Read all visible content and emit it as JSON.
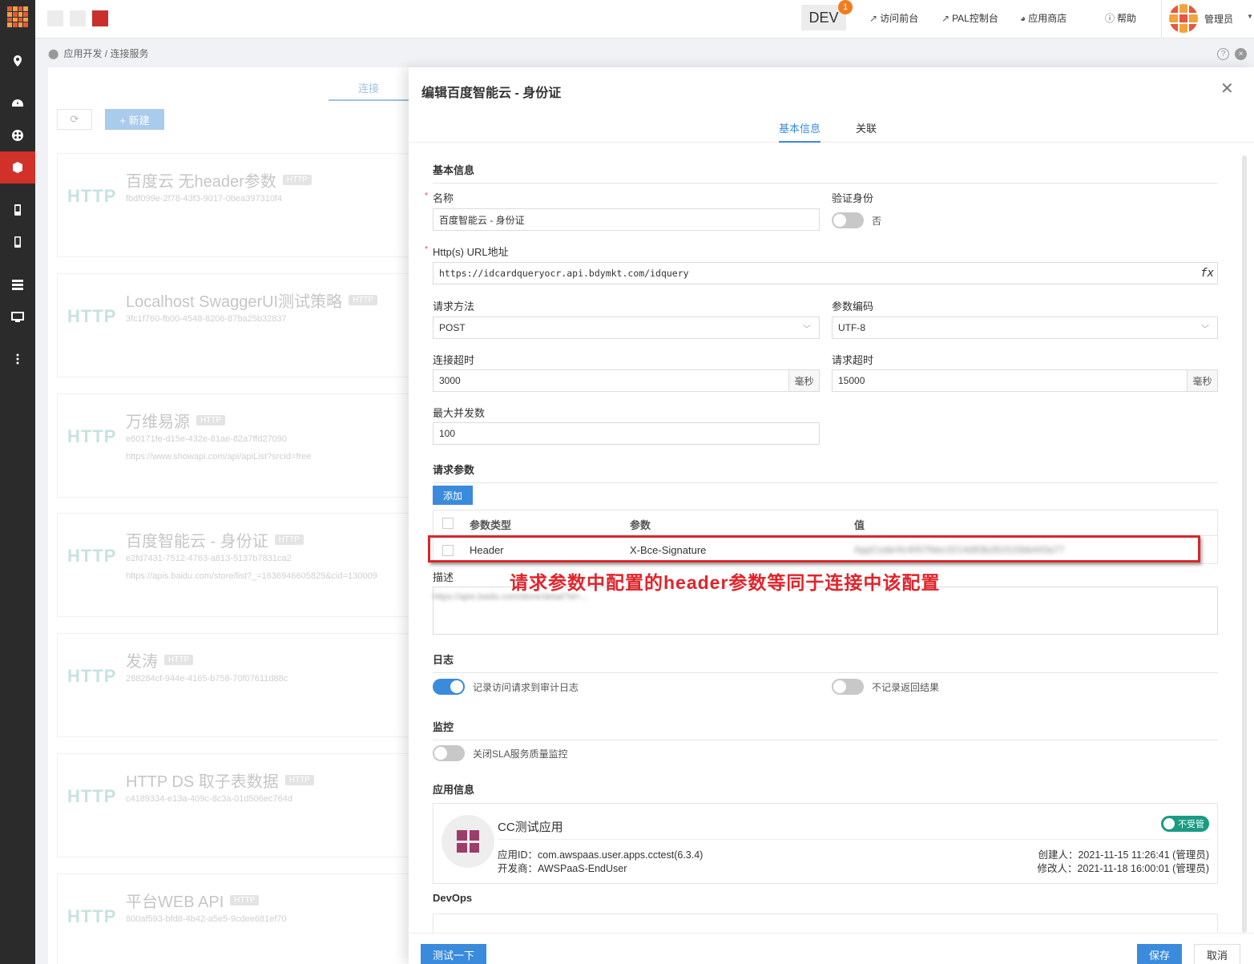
{
  "topbar": {
    "env": "DEV",
    "env_badge": "1",
    "links": {
      "front": "访问前台",
      "pal": "PAL控制台",
      "store": "应用商店",
      "help": "帮助"
    },
    "user": "管理员"
  },
  "breadcrumb": "应用开发 / 连接服务",
  "list": {
    "tab": "连接",
    "new_button": "+ 新建",
    "cards": [
      {
        "protocol": "HTTP",
        "name": "百度云 无header参数",
        "badge": "HTTP",
        "id": "fbdf099e-2f78-43f3-9017-0bea397310f4",
        "url": ""
      },
      {
        "protocol": "HTTP",
        "name": "Localhost SwaggerUI测试策略",
        "badge": "HTTP",
        "id": "3fc1f760-fb00-4548-8206-87ba25b32837",
        "url": ""
      },
      {
        "protocol": "HTTP",
        "name": "万维易源",
        "badge": "HTTP",
        "id": "e60171fe-d15e-432e-81ae-82a7ffd27090",
        "url": "https://www.showapi.com/api/apiList?srcId=free"
      },
      {
        "protocol": "HTTP",
        "name": "百度智能云 - 身份证",
        "badge": "HTTP",
        "id": "e2fd7431-7512-4763-a813-5137b7831ca2",
        "url": "https://apis.baidu.com/store/list?_=1636946605829&cid=130009"
      },
      {
        "protocol": "HTTP",
        "name": "发涛",
        "badge": "HTTP",
        "id": "288284cf-944e-4165-b758-70f07611d88c",
        "url": ""
      },
      {
        "protocol": "HTTP",
        "name": "HTTP DS 取子表数据",
        "badge": "HTTP",
        "id": "c4189334-e13a-409c-8c3a-01d506ec764d",
        "url": ""
      },
      {
        "protocol": "HTTP",
        "name": "平台WEB API",
        "badge": "HTTP",
        "id": "800af593-bfd8-4b42-a5e5-9cdee681ef70",
        "url": ""
      }
    ]
  },
  "drawer": {
    "title": "编辑百度智能云 - 身份证",
    "tabs": [
      "基本信息",
      "关联"
    ],
    "basic_section": "基本信息",
    "name_label": "名称",
    "name_value": "百度智能云 - 身份证",
    "auth_label": "验证身份",
    "auth_value": "否",
    "url_label": "Http(s) URL地址",
    "url_value": "https://idcardqueryocr.api.bdymkt.com/idquery",
    "fx": "fx",
    "method_label": "请求方法",
    "method_value": "POST",
    "encoding_label": "参数编码",
    "encoding_value": "UTF-8",
    "conn_timeout_label": "连接超时",
    "conn_timeout_value": "3000",
    "req_timeout_label": "请求超时",
    "req_timeout_value": "15000",
    "unit_ms": "毫秒",
    "max_concurrency_label": "最大并发数",
    "max_concurrency_value": "100",
    "params_section": "请求参数",
    "add_button": "添加",
    "params_headers": [
      "参数类型",
      "参数",
      "值"
    ],
    "params_rows": [
      {
        "type": "Header",
        "param": "X-Bce-Signature",
        "value": "AppCode/4c4007fdec3214d93b261515bb443a77"
      }
    ],
    "annotation": "请求参数中配置的header参数等同于连接中该配置",
    "desc_label": "描述",
    "desc_value": "https://apis.baidu.com/store/detail?id=...",
    "log_section": "日志",
    "log_toggle1": "记录访问请求到审计日志",
    "log_toggle2": "不记录返回结果",
    "monitor_section": "监控",
    "monitor_toggle": "关闭SLA服务质量监控",
    "appinfo_section": "应用信息",
    "app": {
      "name": "CC测试应用",
      "status": "不受管",
      "id_line": "应用ID：com.awspaas.user.apps.cctest(6.3.4)",
      "dev_line": "开发商：AWSPaaS-EndUser",
      "created": "创建人：2021-11-15 11:26:41 (管理员)",
      "modified": "修改人：2021-11-18 16:00:01 (管理员)"
    },
    "devops_section": "DevOps",
    "test_button": "测试一下",
    "save_button": "保存",
    "cancel_button": "取消"
  }
}
